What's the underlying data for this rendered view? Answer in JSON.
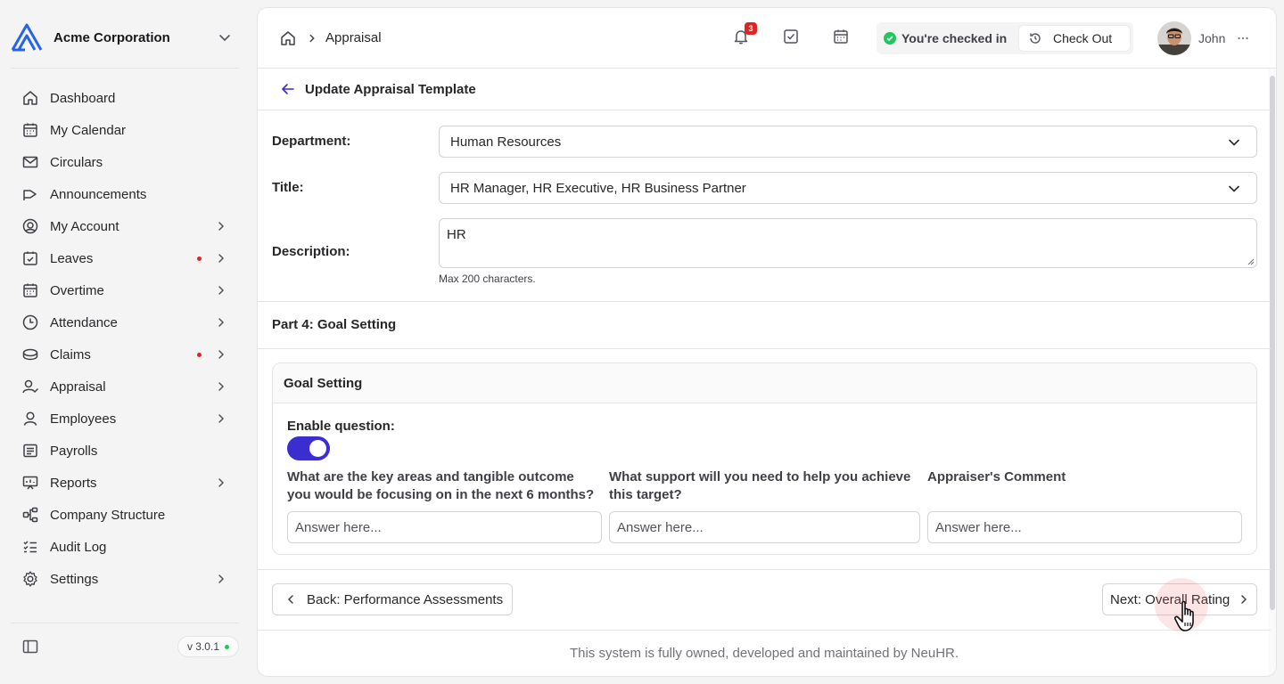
{
  "org": {
    "name": "Acme Corporation"
  },
  "nav": [
    {
      "label": "Dashboard",
      "icon": "home-icon"
    },
    {
      "label": "My Calendar",
      "icon": "calendar-icon"
    },
    {
      "label": "Circulars",
      "icon": "mail-icon"
    },
    {
      "label": "Announcements",
      "icon": "megaphone-icon"
    },
    {
      "label": "My Account",
      "icon": "user-circle-icon"
    },
    {
      "label": "Leaves",
      "icon": "calendar-check-icon"
    },
    {
      "label": "Overtime",
      "icon": "calendar-icon"
    },
    {
      "label": "Attendance",
      "icon": "clock-icon"
    },
    {
      "label": "Claims",
      "icon": "coins-icon"
    },
    {
      "label": "Appraisal",
      "icon": "user-check-icon"
    },
    {
      "label": "Employees",
      "icon": "user-icon"
    },
    {
      "label": "Payrolls",
      "icon": "receipt-icon"
    },
    {
      "label": "Reports",
      "icon": "presentation-icon"
    },
    {
      "label": "Company Structure",
      "icon": "org-chart-icon"
    },
    {
      "label": "Audit Log",
      "icon": "list-checks-icon"
    },
    {
      "label": "Settings",
      "icon": "gear-icon"
    }
  ],
  "version": "v 3.0.1",
  "header": {
    "breadcrumb": "Appraisal",
    "notification_count": "3",
    "checked_in_text": "You're checked in",
    "checkout_label": "Check Out",
    "user_name": "John"
  },
  "page": {
    "title": "Update Appraisal Template",
    "department_label": "Department:",
    "department_value": "Human Resources",
    "title_label": "Title:",
    "title_value": "HR Manager, HR Executive, HR Business Partner",
    "description_label": "Description:",
    "description_value": "HR",
    "description_hint": "Max 200 characters.",
    "section_title": "Part 4: Goal Setting"
  },
  "card": {
    "header": "Goal Setting",
    "enable_label": "Enable question:",
    "enabled": true,
    "questions": [
      {
        "label": "What are the key areas and tangible outcome you would be focusing on in the next 6 months?",
        "placeholder": "Answer here..."
      },
      {
        "label": "What support will you need to help you achieve this target?",
        "placeholder": "Answer here..."
      },
      {
        "label": "Appraiser's Comment",
        "placeholder": "Answer here..."
      }
    ]
  },
  "actions": {
    "back_label": "Back: Performance Assessments",
    "next_label": "Next: Overall Rating"
  },
  "footer": "This system is fully owned, developed and maintained by NeuHR.",
  "colors": {
    "accent": "#3b2ed0",
    "brand_logo": "#2563eb",
    "danger": "#dc2626",
    "success": "#22c55e"
  }
}
